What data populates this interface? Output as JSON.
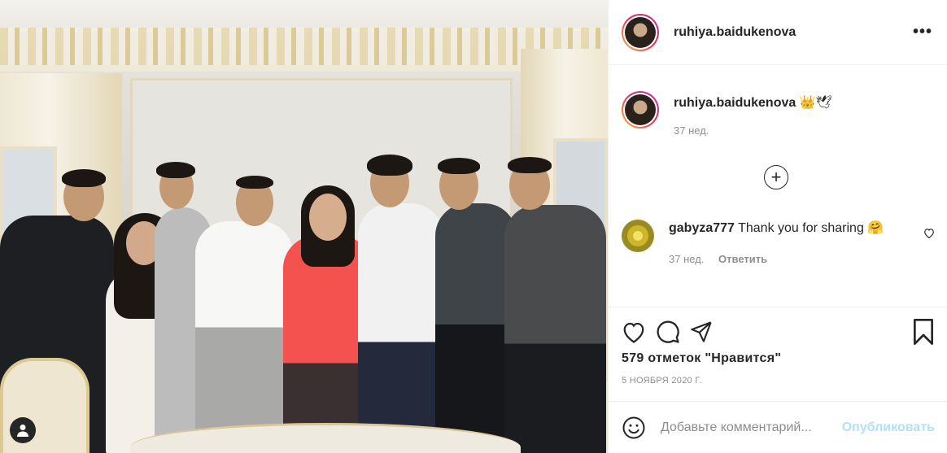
{
  "photo": {
    "alt_present": false
  },
  "header": {
    "username": "ruhiya.baidukenova",
    "more_label": "•••"
  },
  "caption": {
    "username": "ruhiya.baidukenova",
    "text": "👑🕊",
    "time": "37 нед."
  },
  "load_more_label": "+",
  "comments": [
    {
      "username": "gabyza777",
      "text": "Thank you for sharing 🤗",
      "time": "37 нед.",
      "reply_label": "Ответить"
    }
  ],
  "likes_text": "579 отметок \"Нравится\"",
  "date_text": "5 НОЯБРЯ 2020 Г.",
  "add_comment": {
    "placeholder": "Добавьте комментарий...",
    "publish_label": "Опубликовать"
  },
  "icons": {
    "like": "heart-icon",
    "comment": "comment-icon",
    "share": "paper-plane-icon",
    "save": "bookmark-icon",
    "emoji": "smiley-icon",
    "user_tag": "user-tag-icon"
  },
  "colors": {
    "text": "#262626",
    "muted": "#8e8e8e",
    "publish_disabled": "#b2dffc",
    "ring_start": "#f9b93a",
    "ring_end": "#c32aa3"
  }
}
